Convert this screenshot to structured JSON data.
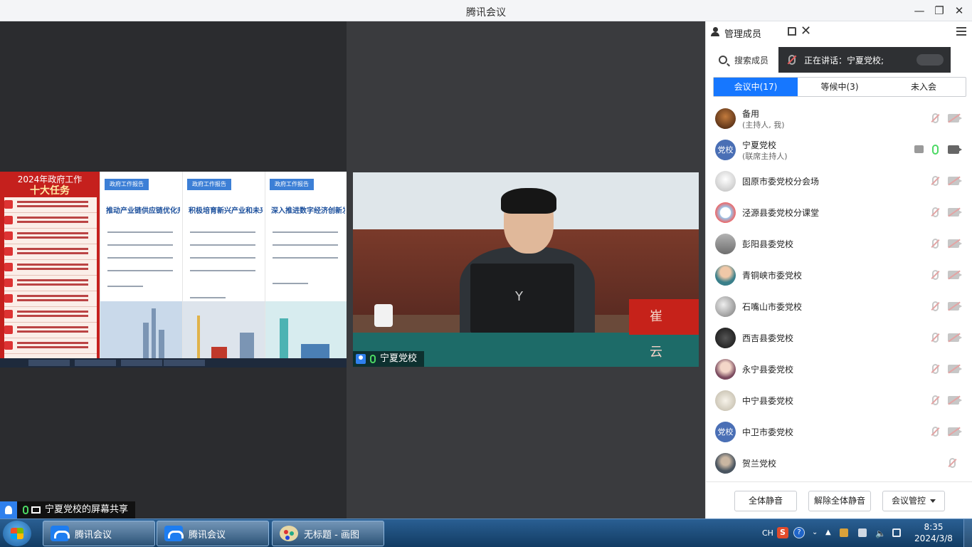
{
  "window": {
    "title": "腾讯会议"
  },
  "screen_share": {
    "banner_line1": "2024年政府工作",
    "banner_line2": "十大任务",
    "panels": [
      {
        "tag": "政府工作报告",
        "heading": "推动产业链供应链优化升级"
      },
      {
        "tag": "政府工作报告",
        "heading": "积极培育新兴产业和未来产业"
      },
      {
        "tag": "政府工作报告",
        "heading": "深入推进数字经济创新发展"
      }
    ],
    "label": "宁夏党校的屏幕共享"
  },
  "speaker_video": {
    "name": "宁夏党校",
    "nameplate": "崔 云"
  },
  "sidebar": {
    "title": "管理成员",
    "search_placeholder": "搜索成员",
    "speaking_text": "正在讲话：宁夏党校;",
    "tabs": [
      {
        "label": "会议中(17)",
        "active": true
      },
      {
        "label": "等候中(3)",
        "active": false
      },
      {
        "label": "未入会",
        "active": false
      }
    ],
    "members": [
      {
        "name": "备用",
        "role": "(主持人, 我)",
        "avatar_color": "#6b3a1e",
        "mic": "off",
        "cam": "off"
      },
      {
        "name": "宁夏党校",
        "role": "(联席主持人)",
        "avatar_text": "党校",
        "avatar_color": "#4a6fb5",
        "mic": "on",
        "cam": "on",
        "sharing": true
      },
      {
        "name": "固原市委党校分会场",
        "avatar_color": "#d9d9d9",
        "mic": "off",
        "cam": "off"
      },
      {
        "name": "泾源县委党校分课堂",
        "avatar_color": "#9cc3e6",
        "mic": "off",
        "cam": "off"
      },
      {
        "name": "彭阳县委党校",
        "avatar_color": "#8d8d8d",
        "mic": "off",
        "cam": "off"
      },
      {
        "name": "青铜峡市委党校",
        "avatar_color": "#6aa3a8",
        "mic": "off",
        "cam": "off"
      },
      {
        "name": "石嘴山市委党校",
        "avatar_color": "#b0b0b0",
        "mic": "off",
        "cam": "off"
      },
      {
        "name": "西吉县委党校",
        "avatar_color": "#2a2a2a",
        "mic": "off",
        "cam": "off"
      },
      {
        "name": "永宁县委党校",
        "avatar_color": "#8a5f6e",
        "mic": "off",
        "cam": "off"
      },
      {
        "name": "中宁县委党校",
        "avatar_color": "#d8d3c6",
        "mic": "off",
        "cam": "off"
      },
      {
        "name": "中卫市委党校",
        "avatar_text": "党校",
        "avatar_color": "#4a6fb5",
        "mic": "off",
        "cam": "off"
      },
      {
        "name": "贺兰党校",
        "avatar_color": "#5d6a72",
        "mic": "off"
      }
    ],
    "footer": {
      "mute_all": "全体静音",
      "unmute_all": "解除全体静音",
      "meeting_control": "会议管控"
    }
  },
  "taskbar": {
    "items": [
      "腾讯会议",
      "腾讯会议",
      "无标题 - 画图"
    ],
    "tray": {
      "lang": "CH",
      "sogou": "S",
      "help": "?"
    },
    "time": "8:35",
    "date": "2024/3/8"
  }
}
